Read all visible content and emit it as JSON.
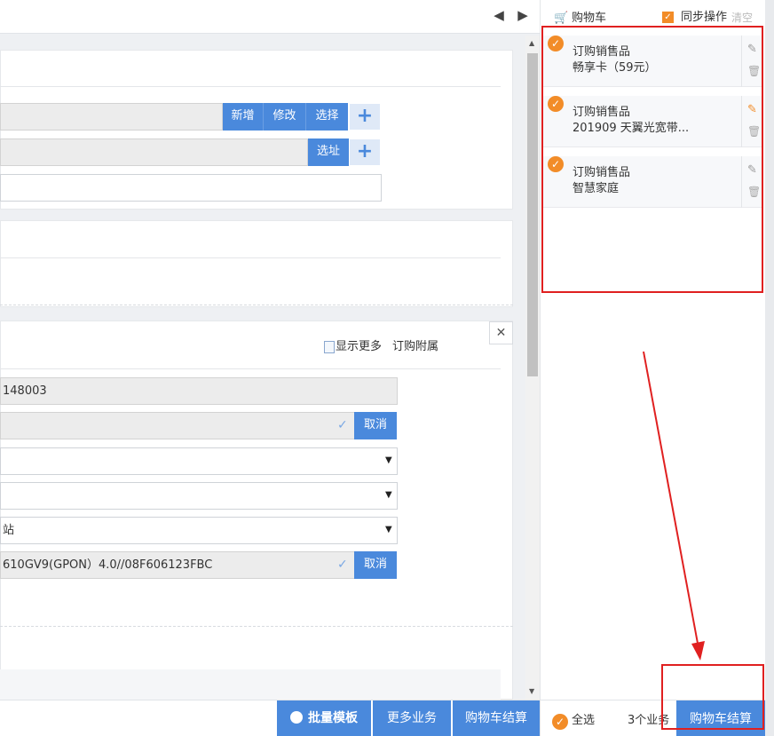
{
  "form": {
    "add_label": "新增",
    "edit_label": "修改",
    "select_label": "选择",
    "addr_select_label": "选址",
    "show_more": "显示更多",
    "subscribe_attach": "订购附属",
    "id_value": "148003",
    "cancel_label": "取消",
    "dropdown3_value": "站",
    "device_value": "610GV9(GPON）4.0//08F606123FBC",
    "cancel2_label": "取消"
  },
  "cart": {
    "title": "购物车",
    "sync_label": "同步操作",
    "clear_label": "清空",
    "items": [
      {
        "line1": "订购销售品",
        "line2": "畅享卡（59元）"
      },
      {
        "line1": "订购销售品",
        "line2": "201909 天翼光宽带..."
      },
      {
        "line1": "订购销售品",
        "line2": "智慧家庭"
      }
    ],
    "select_all": "全选",
    "count_label": "3个业务",
    "checkout_label": "购物车结算"
  },
  "footer": {
    "batch_template": "批量模板",
    "more_business": "更多业务",
    "checkout": "购物车结算"
  },
  "colors": {
    "accent_blue": "#4a89dc",
    "check_orange": "#f28c28",
    "annotation_red": "#e02020"
  }
}
